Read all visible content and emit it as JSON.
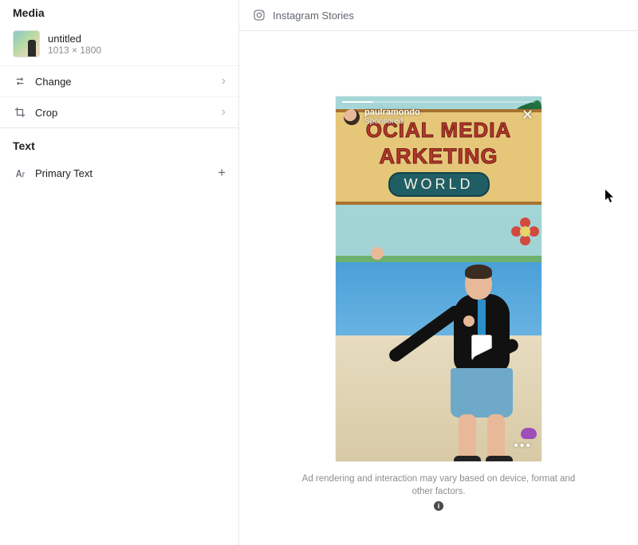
{
  "sidebar": {
    "media": {
      "header": "Media",
      "item": {
        "title": "untitled",
        "dimensions": "1013 × 1800"
      },
      "actions": {
        "change": "Change",
        "crop": "Crop"
      }
    },
    "text": {
      "header": "Text",
      "primary_text": "Primary Text"
    }
  },
  "preview": {
    "header_label": "Instagram Stories",
    "story": {
      "username": "paulramondo",
      "sponsored": "Sponsored",
      "board_line1": "OCIAL MEDIA",
      "board_line2": "ARKETING",
      "board_ribbon": "WORLD"
    },
    "disclaimer": "Ad rendering and interaction may vary based on device, format and other factors."
  }
}
